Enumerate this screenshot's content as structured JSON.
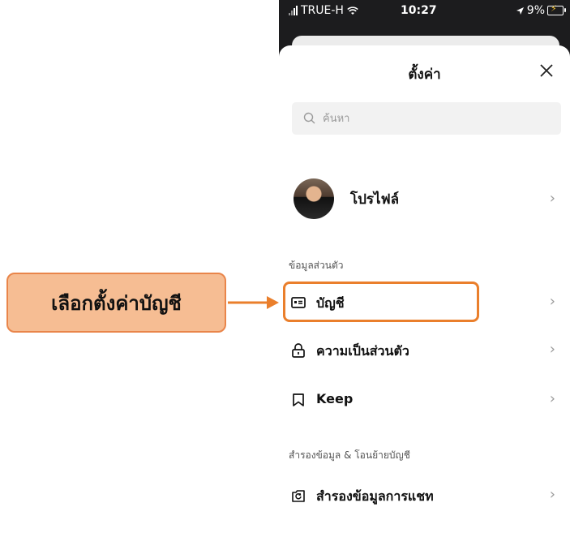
{
  "status_bar": {
    "carrier": "TRUE-H",
    "time": "10:27",
    "battery": "9%"
  },
  "sheet": {
    "title": "ตั้งค่า",
    "close_icon": "close-icon"
  },
  "search": {
    "placeholder": "ค้นหา"
  },
  "profile": {
    "label": "โปรไฟล์"
  },
  "sections": {
    "personal_header": "ข้อมูลส่วนตัว",
    "backup_header": "สำรองข้อมูล & โอนย้ายบัญชี"
  },
  "items": {
    "account": "บัญชี",
    "privacy": "ความเป็นส่วนตัว",
    "keep": "Keep",
    "chat_backup": "สำรองข้อมูลการแชท"
  },
  "annotation": {
    "callout_text": "เลือกตั้งค่าบัญชี",
    "accent_color": "#ea7f2c",
    "callout_fill": "#f6bd93"
  }
}
